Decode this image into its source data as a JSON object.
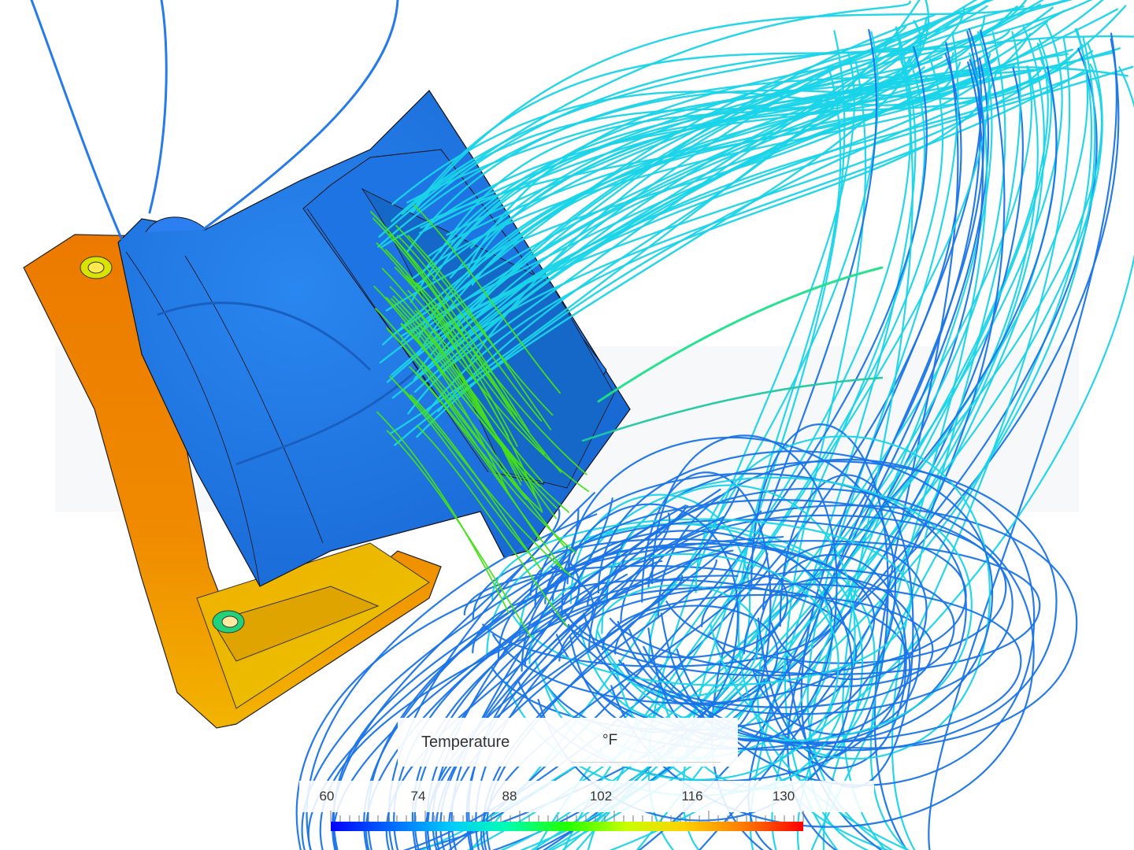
{
  "legend": {
    "title": "Temperature",
    "unit": "°F",
    "ticks": [
      "60",
      "74",
      "88",
      "102",
      "116",
      "130"
    ],
    "min": 60,
    "max": 130,
    "colormap": [
      "#0000ff",
      "#0066ff",
      "#00c8ff",
      "#00ffb0",
      "#22ff00",
      "#c8ff00",
      "#ffd000",
      "#ff7a00",
      "#ff0000"
    ]
  },
  "colors": {
    "fan_body": "#1b72e0",
    "heatsink_orange": "#f08500",
    "heatsink_yellow": "#f5c000",
    "streamline_cool": "#1a74e8",
    "streamline_mid": "#19d4e8",
    "streamline_warm": "#46e018"
  }
}
